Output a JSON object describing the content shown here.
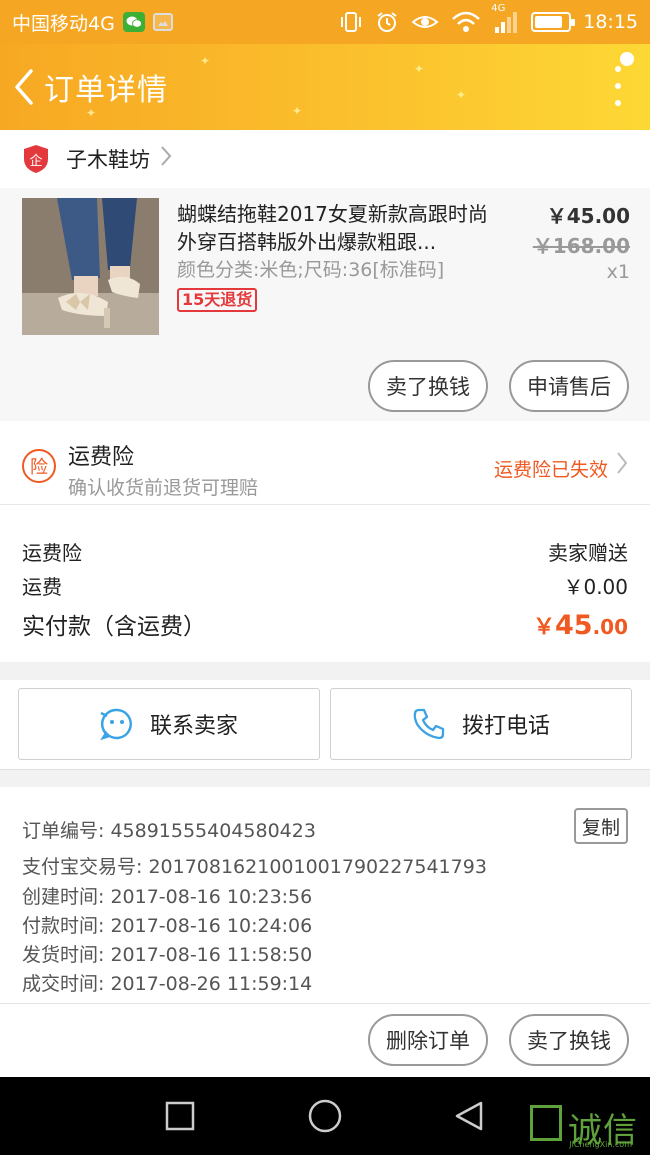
{
  "status_bar": {
    "carrier": "中国移动4G",
    "time": "18:15",
    "network_badge": "4G",
    "battery_level": 0.85
  },
  "header": {
    "title": "订单详情"
  },
  "shop": {
    "name": "子木鞋坊",
    "badge_text": "企"
  },
  "product": {
    "title": "蝴蝶结拖鞋2017女夏新款高跟时尚外穿百搭韩版外出爆款粗跟...",
    "spec": "颜色分类:米色;尺码:36[标准码]",
    "badge": "15天退货",
    "price": "￥45.00",
    "original_price": "￥168.00",
    "quantity": "x1",
    "sell_button": "卖了换钱",
    "aftersale_button": "申请售后"
  },
  "insurance": {
    "icon_text": "险",
    "title": "运费险",
    "subtitle": "确认收货前退货可理赔",
    "status": "运费险已失效"
  },
  "fees": {
    "insurance_label": "运费险",
    "insurance_value": "卖家赠送",
    "shipping_label": "运费",
    "shipping_value": "￥0.00",
    "total_label": "实付款（含运费）",
    "total_currency": "￥",
    "total_int": "45",
    "total_dec": ".00"
  },
  "contact": {
    "seller_button": "联系卖家",
    "phone_button": "拨打电话"
  },
  "order_info": {
    "order_no": "订单编号: 45891555404580423",
    "copy_button": "复制",
    "alipay_no": "支付宝交易号: 2017081621001001790227541793",
    "created": "创建时间: 2017-08-16 10:23:56",
    "paid": "付款时间: 2017-08-16 10:24:06",
    "shipped": "发货时间: 2017-08-16 11:58:50",
    "completed": "成交时间: 2017-08-26 11:59:14"
  },
  "actions": {
    "delete_button": "删除订单",
    "sell_button": "卖了换钱"
  },
  "watermark": {
    "text": "诚信",
    "sub": "JiChengXin.com"
  },
  "colors": {
    "header_start": "#f7a823",
    "header_end": "#fdd835",
    "accent_orange": "#f05a22",
    "badge_red": "#e4393c",
    "chat_blue": "#3aa3e3"
  }
}
